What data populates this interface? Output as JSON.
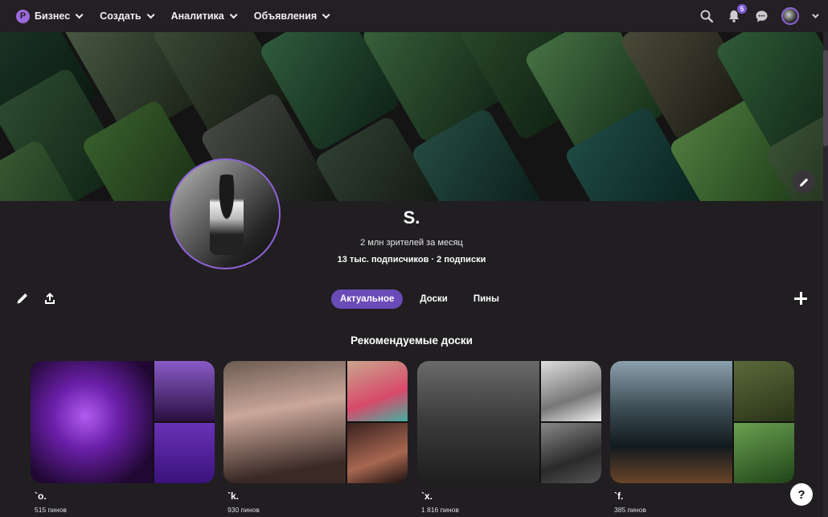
{
  "nav": {
    "items": [
      {
        "label": "Бизнес"
      },
      {
        "label": "Создать"
      },
      {
        "label": "Аналитика"
      },
      {
        "label": "Объявления"
      }
    ],
    "notifications_count": "5",
    "brand_color": "#9b6bdc"
  },
  "profile": {
    "name": "S.",
    "monthly_viewers": "2 млн зрителей за месяц",
    "follow_stats": "13 тыс. подписчиков · 2 подписки"
  },
  "tabs": [
    {
      "label": "Актуальное",
      "active": true
    },
    {
      "label": "Доски",
      "active": false
    },
    {
      "label": "Пины",
      "active": false
    }
  ],
  "section": {
    "title": "Рекомендуемые доски"
  },
  "boards": [
    {
      "name": "`o.",
      "count": "515 пинов"
    },
    {
      "name": "`k.",
      "count": "930 пинов"
    },
    {
      "name": "`x.",
      "count": "1 816 пинов"
    },
    {
      "name": "`f.",
      "count": "385 пинов"
    }
  ],
  "help": {
    "label": "?"
  },
  "colors": {
    "accent": "#6a4bb7",
    "background": "#211e22"
  }
}
